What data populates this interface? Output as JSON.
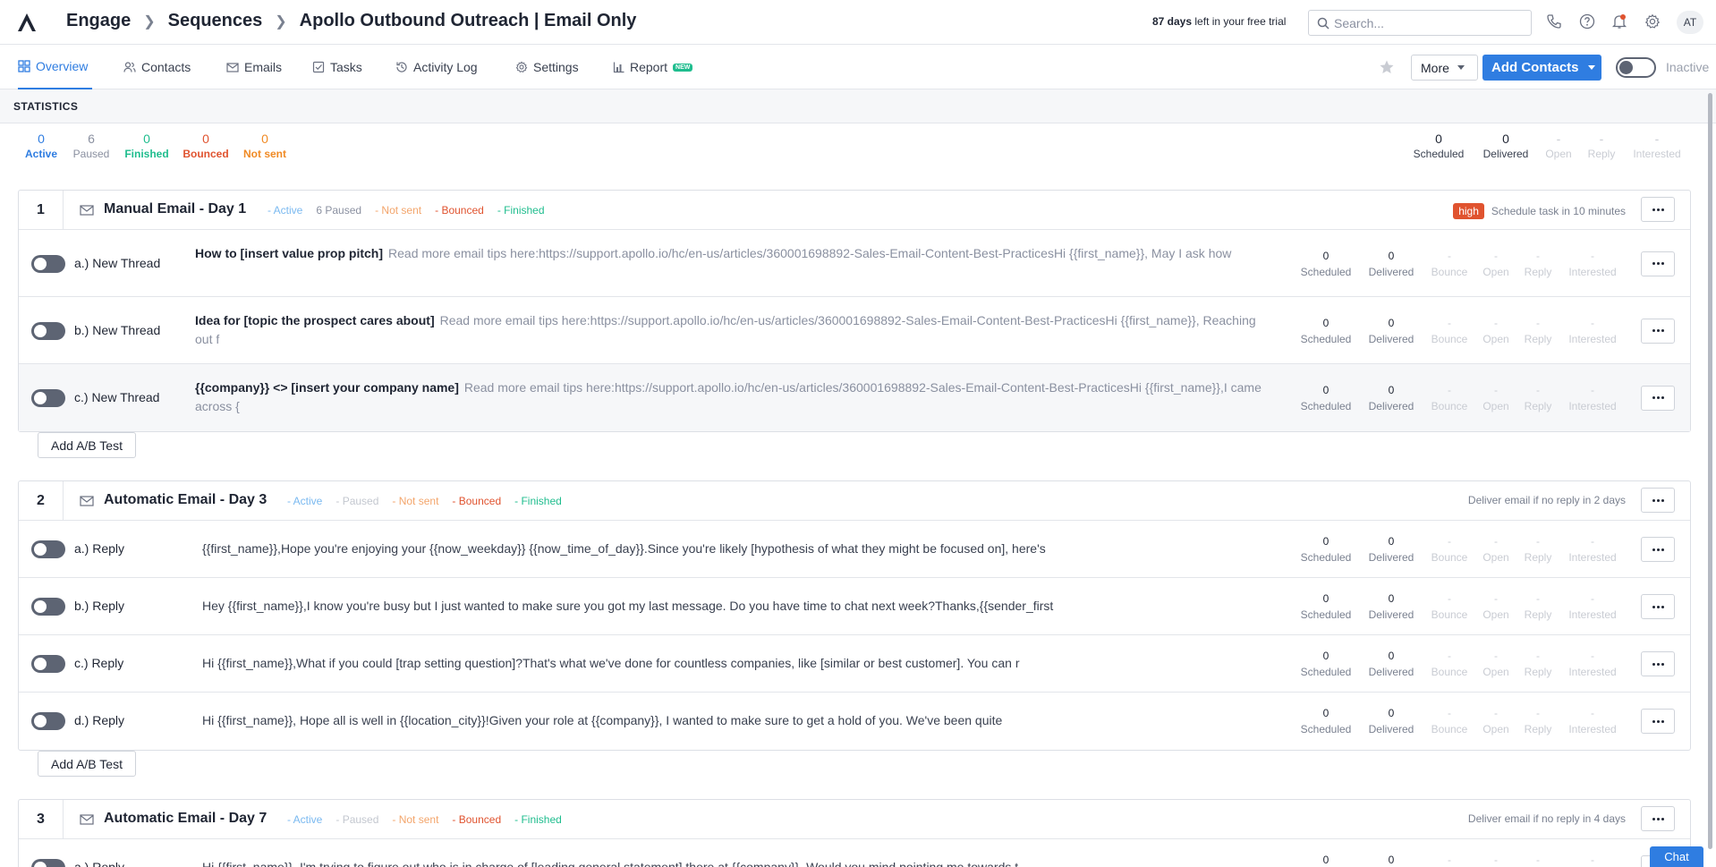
{
  "header": {
    "breadcrumb": [
      "Engage",
      "Sequences",
      "Apollo Outbound Outreach | Email Only"
    ],
    "trial_days": "87 days",
    "trial_rest": "left in your free trial",
    "search_placeholder": "Search...",
    "avatar": "AT",
    "icons": [
      "phone-icon",
      "help-icon",
      "bell-icon",
      "gear-icon"
    ]
  },
  "tabs": [
    {
      "label": "Overview",
      "icon": "grid-icon",
      "active": true
    },
    {
      "label": "Contacts",
      "icon": "users-icon"
    },
    {
      "label": "Emails",
      "icon": "mail-icon"
    },
    {
      "label": "Tasks",
      "icon": "checkbox-icon"
    },
    {
      "label": "Activity Log",
      "icon": "history-icon"
    },
    {
      "label": "Settings",
      "icon": "gear-icon"
    },
    {
      "label": "Report",
      "icon": "chart-icon",
      "badge": "NEW"
    }
  ],
  "actions": {
    "more": "More",
    "add_contacts": "Add Contacts",
    "status": "Inactive"
  },
  "statistics": {
    "title": "STATISTICS",
    "left": [
      {
        "value": "0",
        "label": "Active",
        "color": "#2f7de1"
      },
      {
        "value": "6",
        "label": "Paused",
        "color": "#8a90a0"
      },
      {
        "value": "0",
        "label": "Finished",
        "color": "#1fbd8e"
      },
      {
        "value": "0",
        "label": "Bounced",
        "color": "#e0532f"
      },
      {
        "value": "0",
        "label": "Not sent",
        "color": "#f08a24"
      }
    ],
    "right": [
      {
        "value": "0",
        "label": "Scheduled",
        "faint": false
      },
      {
        "value": "0",
        "label": "Delivered",
        "faint": false
      },
      {
        "value": "-",
        "label": "Open",
        "faint": true
      },
      {
        "value": "-",
        "label": "Reply",
        "faint": true
      },
      {
        "value": "-",
        "label": "Interested",
        "faint": true
      }
    ]
  },
  "row_stat_labels": [
    "Scheduled",
    "Delivered",
    "Bounce",
    "Open",
    "Reply",
    "Interested"
  ],
  "row_stat_values": [
    "0",
    "0",
    "-",
    "-",
    "-",
    "-"
  ],
  "add_ab": "Add A/B Test",
  "steps": [
    {
      "num": "1",
      "title": "Manual Email - Day 1",
      "chips": [
        "- Active",
        "6 Paused",
        "- Not sent",
        "- Bounced",
        "- Finished"
      ],
      "priority": "high",
      "right_text": "Schedule task in 10 minutes",
      "rows": [
        {
          "variant": "a.) New Thread",
          "subject": "How to [insert value prop pitch]",
          "body": "Read more email tips here:https://support.apollo.io/hc/en-us/articles/360001698892-Sales-Email-Content-Best-PracticesHi {{first_name}}, May I ask how"
        },
        {
          "variant": "b.) New Thread",
          "subject": "Idea for [topic the prospect cares about]",
          "body": "Read more email tips here:https://support.apollo.io/hc/en-us/articles/360001698892-Sales-Email-Content-Best-PracticesHi {{first_name}}, Reaching out f"
        },
        {
          "variant": "c.) New Thread",
          "subject": "{{company}} <> [insert your company name]",
          "body": "Read more email tips here:https://support.apollo.io/hc/en-us/articles/360001698892-Sales-Email-Content-Best-PracticesHi {{first_name}},I came across {"
        }
      ]
    },
    {
      "num": "2",
      "title": "Automatic Email - Day 3",
      "chips": [
        "- Active",
        "- Paused",
        "- Not sent",
        "- Bounced",
        "- Finished"
      ],
      "right_text": "Deliver email if no reply in 2 days",
      "rows": [
        {
          "variant": "a.) Reply",
          "body": "{{first_name}},Hope you're enjoying your {{now_weekday}} {{now_time_of_day}}.Since you're likely [hypothesis of what they might be focused on], here's"
        },
        {
          "variant": "b.) Reply",
          "body": "Hey {{first_name}},I know you're busy but I just wanted to make sure you got my last message. Do you have time to chat next week?Thanks,{{sender_first"
        },
        {
          "variant": "c.) Reply",
          "body": "Hi {{first_name}},What if you could [trap setting question]?That's what we've done for countless companies, like [similar or best customer]. You can r"
        },
        {
          "variant": "d.) Reply",
          "body": "Hi {{first_name}}, Hope all is well in {{location_city}}!Given your role at {{company}}, I wanted to make sure to get a hold of you. We've been quite"
        }
      ]
    },
    {
      "num": "3",
      "title": "Automatic Email - Day 7",
      "chips": [
        "- Active",
        "- Paused",
        "- Not sent",
        "- Bounced",
        "- Finished"
      ],
      "right_text": "Deliver email if no reply in 4 days",
      "rows": [
        {
          "variant": "a.) Reply",
          "body": "Hi {{first_name}}, I'm trying to figure out who is in charge of [leading general statement] there at {{company}}. Would you mind pointing me towards t"
        }
      ]
    }
  ],
  "chat": "Chat"
}
